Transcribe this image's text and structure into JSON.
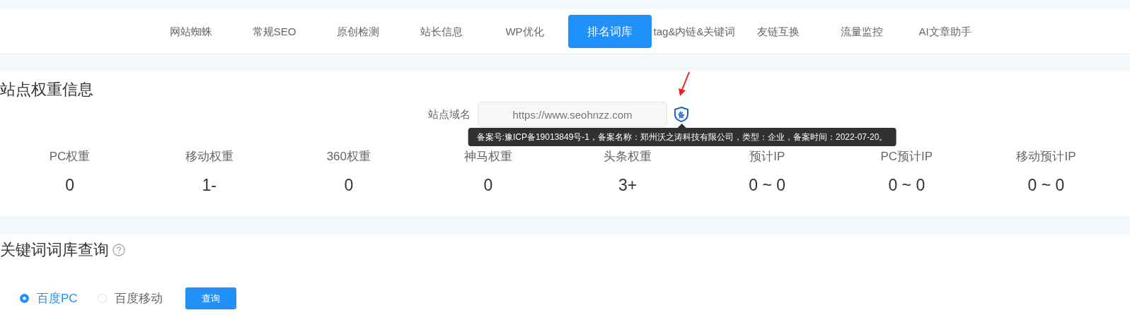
{
  "nav": {
    "tabs": [
      {
        "label": "网站蜘蛛",
        "selected": false
      },
      {
        "label": "常规SEO",
        "selected": false
      },
      {
        "label": "原创检测",
        "selected": false
      },
      {
        "label": "站长信息",
        "selected": false
      },
      {
        "label": "WP优化",
        "selected": false
      },
      {
        "label": "排名词库",
        "selected": true
      },
      {
        "label": "tag&内链&关键词",
        "selected": false
      },
      {
        "label": "友链互换",
        "selected": false
      },
      {
        "label": "流量监控",
        "selected": false
      },
      {
        "label": "AI文章助手",
        "selected": false
      }
    ]
  },
  "weight_section": {
    "title": "站点权重信息",
    "domain_label": "站点域名",
    "domain_value": "https://www.seohnzz.com",
    "badge": "备",
    "tooltip": "备案号:豫ICP备19013849号-1，备案名称：郑州沃之涛科技有限公司，类型：企业，备案时间：2022-07-20。",
    "stats": [
      {
        "label": "PC权重",
        "value": "0"
      },
      {
        "label": "移动权重",
        "value": "1-"
      },
      {
        "label": "360权重",
        "value": "0"
      },
      {
        "label": "神马权重",
        "value": "0"
      },
      {
        "label": "头条权重",
        "value": "3+"
      },
      {
        "label": "预计IP",
        "value": "0 ~ 0"
      },
      {
        "label": "PC预计IP",
        "value": "0 ~ 0"
      },
      {
        "label": "移动预计IP",
        "value": "0 ~ 0"
      }
    ]
  },
  "keyword_section": {
    "title": "关键词词库查询",
    "options": [
      {
        "label": "百度PC",
        "selected": true
      },
      {
        "label": "百度移动",
        "selected": false
      }
    ],
    "button": "查询"
  }
}
